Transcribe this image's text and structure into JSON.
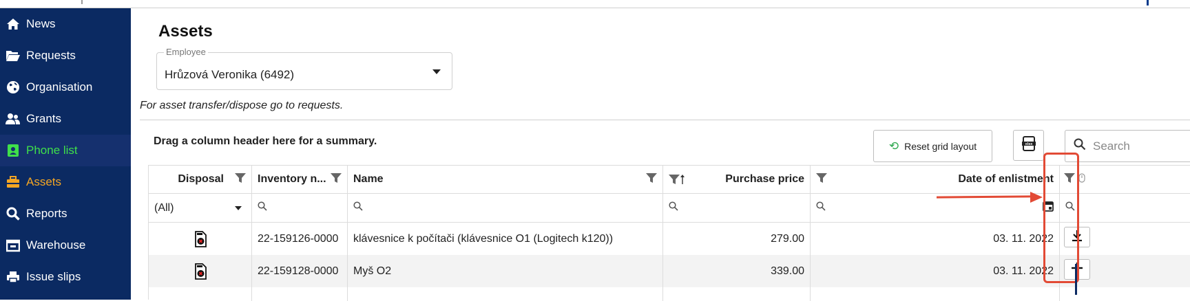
{
  "sidebar": {
    "items": [
      {
        "label": "News",
        "icon": "home-icon"
      },
      {
        "label": "Requests",
        "icon": "folder-open-icon"
      },
      {
        "label": "Organisation",
        "icon": "globe-icon"
      },
      {
        "label": "Grants",
        "icon": "users-icon"
      },
      {
        "label": "Phone list",
        "icon": "phone-book-icon",
        "state": "hover",
        "color": "#3fe04a"
      },
      {
        "label": "Assets",
        "icon": "briefcase-icon",
        "state": "active",
        "color": "#f5a623"
      },
      {
        "label": "Reports",
        "icon": "search-icon"
      },
      {
        "label": "Warehouse",
        "icon": "warehouse-icon"
      },
      {
        "label": "Issue slips",
        "icon": "printer-icon"
      }
    ],
    "background": "#0b2a62"
  },
  "page": {
    "title": "Assets",
    "employee_label": "Employee",
    "employee_value": "Hrůzová Veronika (6492)",
    "note": "For asset transfer/dispose go to requests."
  },
  "toolbar": {
    "group_hint": "Drag a column header here for a summary.",
    "reset_label": "Reset grid layout",
    "search_placeholder": "Search"
  },
  "grid": {
    "columns": [
      "Disposal",
      "Inventory n...",
      "Name",
      "Purchase price",
      "Date of enlistment"
    ],
    "filter_all": "(All)",
    "rows": [
      {
        "inventory": "22-159126-0000",
        "name": "klávesnice k počítači (klávesnice O1 (Logitech k120))",
        "price": "279.00",
        "date": "03. 11. 2022",
        "action": "download-icon"
      },
      {
        "inventory": "22-159128-0000",
        "name": "Myš O2",
        "price": "339.00",
        "date": "03. 11. 2022",
        "action": "plus-icon"
      }
    ]
  },
  "highlight_color": "#e24a35"
}
